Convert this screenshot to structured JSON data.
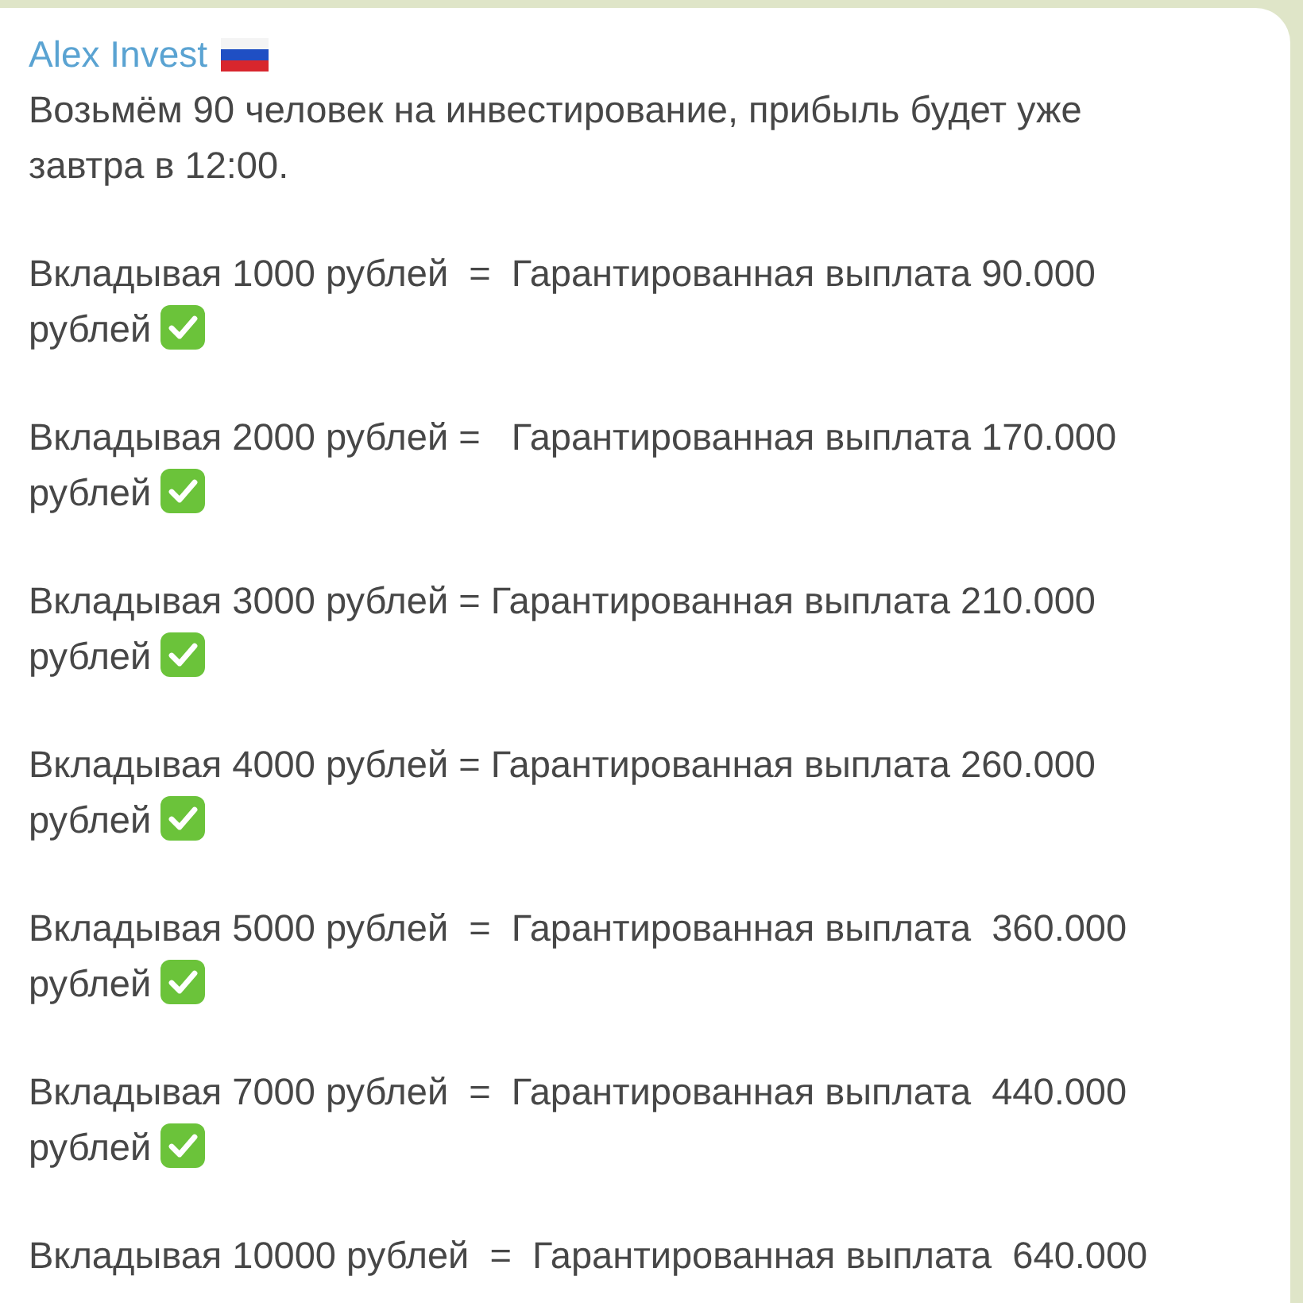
{
  "message": {
    "author": "Alex Invest",
    "intro": "Возьмём 90 человек на инвестирование, прибыль будет уже\nзавтра в 12:00.",
    "offers": [
      {
        "text": "Вкладывая 1000 рублей  =  Гарантированная выплата 90.000\nрублей",
        "check_mark": true
      },
      {
        "text": "Вкладывая 2000 рублей =   Гарантированная выплата 170.000\nрублей",
        "check_mark": true
      },
      {
        "text": "Вкладывая 3000 рублей = Гарантированная выплата 210.000\nрублей",
        "check_mark": true
      },
      {
        "text": "Вкладывая 4000 рублей = Гарантированная выплата 260.000\nрублей",
        "check_mark": true
      },
      {
        "text": "Вкладывая 5000 рублей  =  Гарантированная выплата  360.000\nрублей",
        "check_mark": true
      },
      {
        "text": "Вкладывая 7000 рублей  =  Гарантированная выплата  440.000\nрублей",
        "check_mark": true
      },
      {
        "text": "Вкладывая 10000 рублей  =  Гарантированная выплата  640.000",
        "check_mark": false
      }
    ]
  }
}
